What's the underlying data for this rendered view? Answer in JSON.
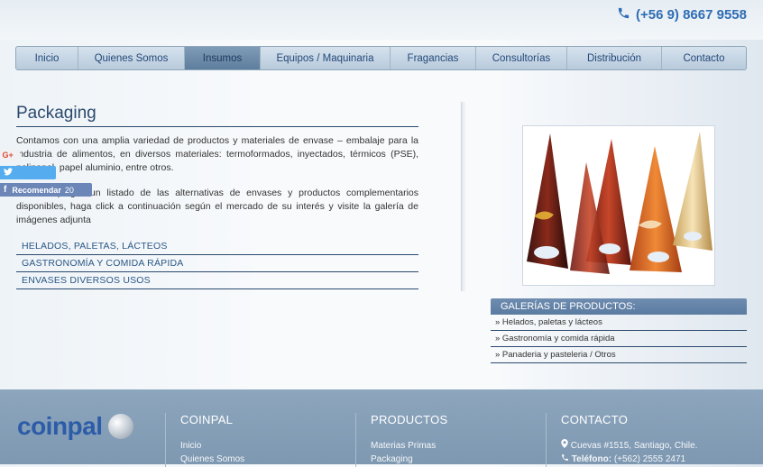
{
  "header": {
    "phone": "(+56 9) 8667 9558"
  },
  "nav": {
    "items": [
      {
        "label": "Inicio",
        "active": false
      },
      {
        "label": "Quienes Somos",
        "active": false
      },
      {
        "label": "Insumos",
        "active": true
      },
      {
        "label": "Equipos / Maquinaria",
        "active": false
      },
      {
        "label": "Fragancias",
        "active": false
      },
      {
        "label": "Consultorías",
        "active": false
      },
      {
        "label": "Distribución",
        "active": false
      },
      {
        "label": "Contacto",
        "active": false
      }
    ]
  },
  "main": {
    "title": "Packaging",
    "p1": "Contamos con una amplia variedad de productos y materiales de envase – embalaje para la industria de alimentos, en diversos materiales: termoformados, inyectados, térmicos (PSE), polipapel, papel aluminio, entre otros.",
    "p2": "Para desplegar un listado de las alternativas de envases y productos complementarios disponibles, haga click a continuación según el mercado de su interés y visite la galería de imágenes adjunta",
    "links": [
      "HELADOS, PALETAS, LÁCTEOS",
      "GASTRONOMÍA Y COMIDA RÁPIDA",
      "ENVASES DIVERSOS USOS"
    ]
  },
  "social": {
    "recommend_label": "Recomendar",
    "recommend_count": "20"
  },
  "gallery": {
    "heading": "GALERÍAS DE PRODUCTOS:",
    "items": [
      "» Helados, paletas y lácteos",
      "» Gastronomía y comida rápida",
      "» Panaderia y pasteleria / Otros"
    ]
  },
  "footer": {
    "logo": "coinpal",
    "col1": {
      "title": "COINPAL",
      "items": [
        "Inicio",
        "Quienes Somos"
      ]
    },
    "col2": {
      "title": "PRODUCTOS",
      "items": [
        "Materias Primas",
        "Packaging"
      ]
    },
    "col3": {
      "title": "CONTACTO",
      "address": "Cuevas #1515, Santiago, Chile.",
      "phone_label": "Teléfono:",
      "phone": "(+562) 2555 2471"
    }
  },
  "colors": {
    "accent": "#2f6db4",
    "nav_active": "#6a89aa",
    "footer": "#8aa3bb"
  }
}
